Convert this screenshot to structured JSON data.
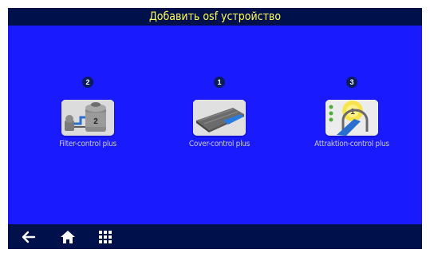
{
  "header": {
    "title": "Добавить osf устройство"
  },
  "devices": [
    {
      "badge": "2",
      "label": "Filter-control plus",
      "icon": "filter-tank-icon"
    },
    {
      "badge": "1",
      "label": "Cover-control plus",
      "icon": "pool-cover-icon"
    },
    {
      "badge": "3",
      "label": "Attraktion-control plus",
      "icon": "attraction-slide-icon"
    }
  ],
  "footer": {
    "buttons": [
      "back-arrow-icon",
      "home-icon",
      "grid-menu-icon"
    ]
  },
  "colors": {
    "background": "#1a1aff",
    "bars": "#00104a",
    "title": "#ffff55",
    "badge": "#0a1c5a",
    "label": "#c8c8d8"
  }
}
